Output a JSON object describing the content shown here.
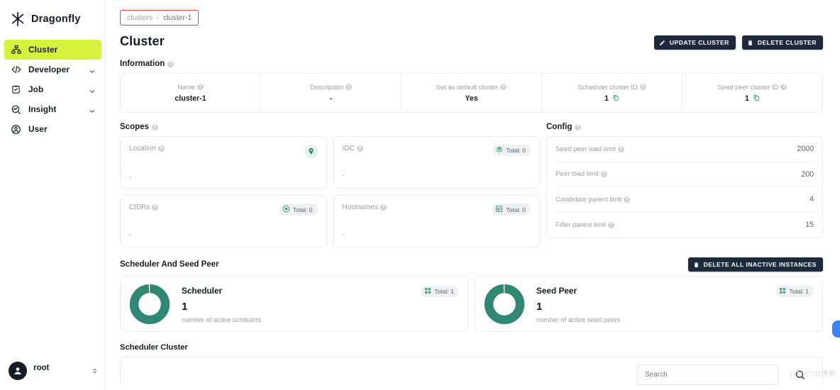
{
  "brand": {
    "name": "Dragonfly",
    "logo_icon": "dragonfly-logo-icon"
  },
  "sidebar": {
    "items": [
      {
        "label": "Cluster",
        "icon": "cluster-icon",
        "active": true,
        "expandable": false
      },
      {
        "label": "Developer",
        "icon": "code-icon",
        "active": false,
        "expandable": true
      },
      {
        "label": "Job",
        "icon": "clipboard-icon",
        "active": false,
        "expandable": true
      },
      {
        "label": "Insight",
        "icon": "insight-icon",
        "active": false,
        "expandable": true
      },
      {
        "label": "User",
        "icon": "user-icon",
        "active": false,
        "expandable": false
      }
    ],
    "user": {
      "name": "root",
      "sub": "-",
      "avatar_icon": "avatar-icon",
      "chevron_icon": "chevron-updown-icon"
    },
    "active_bg": "#d9f23d"
  },
  "breadcrumb": {
    "root": "clusters",
    "separator": "/",
    "current": "cluster-1",
    "highlight_color": "#ef3f3f"
  },
  "header": {
    "title": "Cluster",
    "update_button": "UPDATE CLUSTER",
    "delete_button": "DELETE CLUSTER",
    "button_bg": "#1d2a3b"
  },
  "information": {
    "section_title": "Information",
    "cells": [
      {
        "label": "Name",
        "value": "cluster-1",
        "copy": false
      },
      {
        "label": "Description",
        "value": "-",
        "copy": false
      },
      {
        "label": "Set as default cluster",
        "value": "Yes",
        "copy": false
      },
      {
        "label": "Scheduler cluster ID",
        "value": "1",
        "copy": true
      },
      {
        "label": "Seed peer cluster ID",
        "value": "1",
        "copy": true
      }
    ]
  },
  "scopes": {
    "section_title": "Scopes",
    "cards": [
      {
        "label": "Location",
        "value": "-",
        "badge": null,
        "badge_icon": "location-pin-icon"
      },
      {
        "label": "IDC",
        "value": "-",
        "badge": "Total: 0",
        "badge_icon": "layers-icon"
      },
      {
        "label": "CIDRs",
        "value": "-",
        "badge": "Total: 0",
        "badge_icon": "cidr-icon"
      },
      {
        "label": "Hostnames",
        "value": "-",
        "badge": "Total: 0",
        "badge_icon": "grid-table-icon"
      }
    ]
  },
  "config": {
    "section_title": "Config",
    "rows": [
      {
        "label": "Seed peer load limit",
        "value": "2000"
      },
      {
        "label": "Peer load limit",
        "value": "200"
      },
      {
        "label": "Candidate parent limit",
        "value": "4"
      },
      {
        "label": "Filter parent limit",
        "value": "15"
      }
    ]
  },
  "scheduler_seed_peer": {
    "section_title": "Scheduler And Seed Peer",
    "delete_all_button": "DELETE ALL INACTIVE INSTANCES",
    "cards": [
      {
        "name": "Scheduler",
        "count": "1",
        "sub": "number of active schdulers",
        "badge": "Total: 1",
        "donut_color": "#2f8873",
        "donut_percent": 99
      },
      {
        "name": "Seed Peer",
        "count": "1",
        "sub": "number of active seed peers",
        "badge": "Total: 1",
        "donut_color": "#2f8873",
        "donut_percent": 99
      }
    ]
  },
  "scheduler_cluster": {
    "section_title": "Scheduler Cluster",
    "search_placeholder": "Search",
    "search_value": ""
  },
  "watermark": "@51CTO博客"
}
